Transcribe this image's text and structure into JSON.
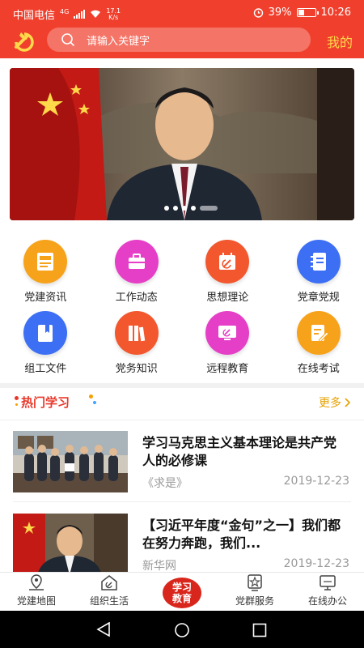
{
  "status_bar": {
    "carrier": "中国电信",
    "network": "4G",
    "speed_value": "17.1",
    "speed_unit": "K/s",
    "battery_text": "39%",
    "battery_level": 0.39,
    "time": "10:26"
  },
  "header": {
    "search_placeholder": "请输入关键字",
    "mine_label": "我的"
  },
  "banner": {
    "slide_count": 5,
    "active_index": 4
  },
  "grid": {
    "rows": [
      [
        {
          "label": "党建资讯",
          "color": "#f7a21b",
          "icon": "newspaper-icon"
        },
        {
          "label": "工作动态",
          "color": "#e63fc7",
          "icon": "briefcase-icon"
        },
        {
          "label": "思想理论",
          "color": "#f2572e",
          "icon": "party-calendar-icon"
        },
        {
          "label": "党章党规",
          "color": "#3d6ff5",
          "icon": "notebook-icon"
        }
      ],
      [
        {
          "label": "组工文件",
          "color": "#3d6ff5",
          "icon": "bookmark-book-icon"
        },
        {
          "label": "党务知识",
          "color": "#f2572e",
          "icon": "books-icon"
        },
        {
          "label": "远程教育",
          "color": "#e63fc7",
          "icon": "monitor-icon"
        },
        {
          "label": "在线考试",
          "color": "#f7a21b",
          "icon": "exam-pen-icon"
        }
      ]
    ]
  },
  "hot": {
    "title": "热门学习",
    "more_label": "更多"
  },
  "news": [
    {
      "title": "学习马克思主义基本理论是共产党人的必修课",
      "source": "《求是》",
      "date": "2019-12-23"
    },
    {
      "title": "【习近平年度“金句”之一】我们都在努力奔跑，我们...",
      "source": "新华网",
      "date": "2019-12-23"
    }
  ],
  "tabbar": {
    "items": [
      {
        "label": "党建地图",
        "icon": "map-pin-icon"
      },
      {
        "label": "组织生活",
        "icon": "party-home-icon"
      },
      {
        "label": "学习教育",
        "icon": "study-badge",
        "center": true
      },
      {
        "label": "党群服务",
        "icon": "star-badge-icon"
      },
      {
        "label": "在线办公",
        "icon": "computer-icon"
      }
    ],
    "center_line1": "学习",
    "center_line2": "教育"
  },
  "colors": {
    "header_red": "#f0402d",
    "mine_yellow": "#ffd94a",
    "hot_red": "#e8382a",
    "more_gold": "#e6a100"
  }
}
